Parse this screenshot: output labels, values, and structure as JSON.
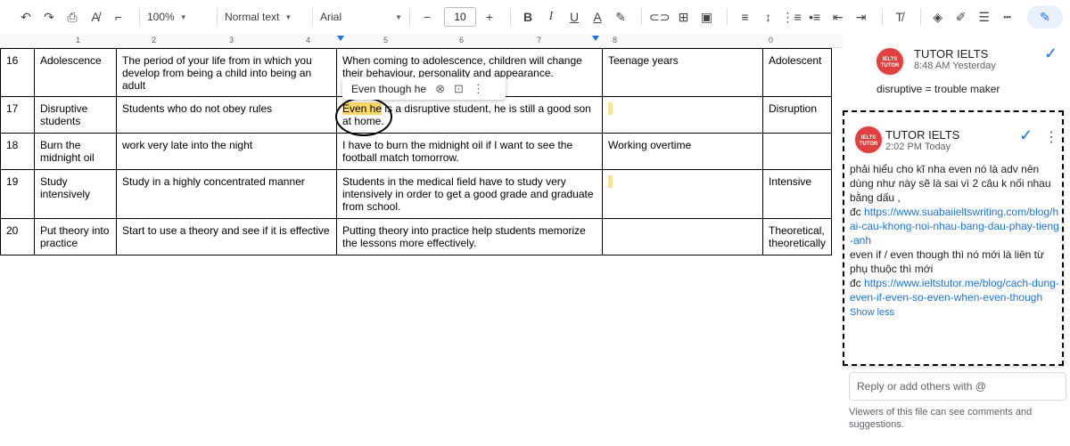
{
  "toolbar": {
    "zoom": "100%",
    "style": "Normal text",
    "font": "Arial",
    "font_size": "10",
    "buttons": [
      "undo",
      "redo",
      "print",
      "spellcheck",
      "paint-format",
      "bold",
      "italic",
      "underline",
      "text-color",
      "highlight",
      "link",
      "comment",
      "image",
      "align",
      "line-spacing",
      "numbered-list",
      "bulleted-list",
      "decrease-indent",
      "increase-indent",
      "clear-formatting",
      "fill-color",
      "border-color",
      "border-width",
      "border-dash",
      "edit-mode"
    ]
  },
  "ruler": {
    "numbers": [
      "1",
      "2",
      "3",
      "4",
      "5",
      "6",
      "7",
      "8",
      "0"
    ]
  },
  "table": {
    "rows": [
      {
        "num": "16",
        "term": "Adolescence",
        "definition": "The period of your life from in which you develop from being a child into being an adult",
        "example": "When coming to adolescence, children will change their behaviour, personality and appearance.",
        "synonym": "Teenage years",
        "related": "Adolescent"
      },
      {
        "num": "17",
        "term": "Disruptive students",
        "definition": "Students who do not obey rules",
        "example_highlight": "Even he",
        "example_rest": " is a disruptive student, he is still a good son at home.",
        "synonym": "",
        "related": "Disruption"
      },
      {
        "num": "18",
        "term": "Burn the midnight oil",
        "definition": "work very late into the night",
        "example": "I have to burn the midnight oil if I want to see the football match tomorrow.",
        "synonym": "Working overtime",
        "related": ""
      },
      {
        "num": "19",
        "term": "Study intensively",
        "definition": "Study in a highly concentrated manner",
        "example": "Students in the medical field have to study very intensively in order to get a good grade and graduate from school.",
        "synonym": "",
        "related": "Intensive"
      },
      {
        "num": "20",
        "term": "Put theory into practice",
        "definition": "Start to use a theory and see if it is effective",
        "example": "Putting theory into practice help students memorize the lessons more effectively.",
        "synonym": "",
        "related": "Theoretical, theoretically"
      }
    ]
  },
  "suggestion": {
    "text": "Even though he"
  },
  "comments": [
    {
      "author": "TUTOR IELTS",
      "time": "8:48 AM Yesterday",
      "body": "disruptive = trouble maker",
      "avatar_text": "IELTS TUTOR"
    },
    {
      "author": "TUTOR IELTS",
      "time": "2:02 PM Today",
      "avatar_text": "IELTS TUTOR",
      "p1": "phải hiểu cho kĩ nha even nó là adv nên dùng như này sẽ là sai vì 2 câu k nối nhau bằng dấu ,",
      "p2_prefix": "đc ",
      "link1": "https://www.suabaiieltswriting.com/blog/hai-cau-khong-noi-nhau-bang-dau-phay-tieng-anh",
      "p3": "even if / even though thì nó mới là liên từ phụ thuộc thì mới",
      "p4_prefix": "đc ",
      "link2": "https://www.ieltstutor.me/blog/cach-dung-even-if-even-so-even-when-even-though",
      "show_less": "Show less"
    }
  ],
  "reply_placeholder": "Reply or add others with @",
  "viewers_note": "Viewers of this file can see comments and suggestions.",
  "colors": {
    "accent": "#1a73e8",
    "highlight": "#fbd966",
    "avatar": "#e2403f"
  }
}
